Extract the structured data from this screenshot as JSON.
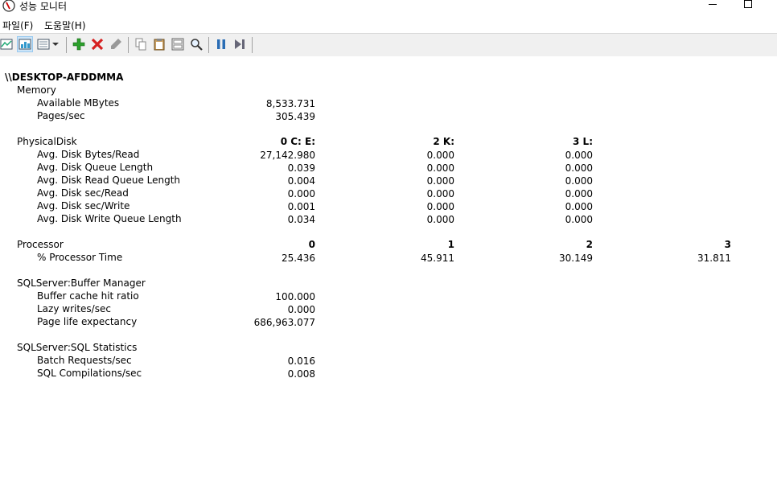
{
  "window": {
    "title": "성능 모니터",
    "icon": "performance-monitor-icon"
  },
  "menu": {
    "file": "파일(F)",
    "help": "도움말(H)"
  },
  "toolbar": {
    "icons": [
      "graph-view-icon",
      "histogram-view-icon",
      "report-view-icon",
      "dropdown-arrow-icon",
      "add-counter-icon",
      "delete-counter-icon",
      "highlight-icon",
      "copy-properties-icon",
      "paste-counter-list-icon",
      "properties-icon",
      "zoom-icon",
      "freeze-display-icon",
      "update-data-icon"
    ]
  },
  "report": {
    "computer": "\\\\DESKTOP-AFDDMMA",
    "memory": {
      "name": "Memory",
      "counters": [
        {
          "label": "Available MBytes",
          "value": "8,533.731"
        },
        {
          "label": "Pages/sec",
          "value": "305.439"
        }
      ]
    },
    "physicaldisk": {
      "name": "PhysicalDisk",
      "instances": [
        "0 C: E:",
        "2 K:",
        "3 L:"
      ],
      "counters": [
        {
          "label": "Avg. Disk Bytes/Read",
          "values": [
            "27,142.980",
            "0.000",
            "0.000"
          ]
        },
        {
          "label": "Avg. Disk Queue Length",
          "values": [
            "0.039",
            "0.000",
            "0.000"
          ]
        },
        {
          "label": "Avg. Disk Read Queue Length",
          "values": [
            "0.004",
            "0.000",
            "0.000"
          ]
        },
        {
          "label": "Avg. Disk sec/Read",
          "values": [
            "0.000",
            "0.000",
            "0.000"
          ]
        },
        {
          "label": "Avg. Disk sec/Write",
          "values": [
            "0.001",
            "0.000",
            "0.000"
          ]
        },
        {
          "label": "Avg. Disk Write Queue Length",
          "values": [
            "0.034",
            "0.000",
            "0.000"
          ]
        }
      ]
    },
    "processor": {
      "name": "Processor",
      "instances": [
        "0",
        "1",
        "2",
        "3"
      ],
      "counters": [
        {
          "label": "% Processor Time",
          "values": [
            "25.436",
            "45.911",
            "30.149",
            "31.811"
          ]
        }
      ]
    },
    "buffer": {
      "name": "SQLServer:Buffer Manager",
      "counters": [
        {
          "label": "Buffer cache hit ratio",
          "value": "100.000"
        },
        {
          "label": "Lazy writes/sec",
          "value": "0.000"
        },
        {
          "label": "Page life expectancy",
          "value": "686,963.077"
        }
      ]
    },
    "sqlstats": {
      "name": "SQLServer:SQL Statistics",
      "counters": [
        {
          "label": "Batch Requests/sec",
          "value": "0.016"
        },
        {
          "label": "SQL Compilations/sec",
          "value": "0.008"
        }
      ]
    }
  }
}
